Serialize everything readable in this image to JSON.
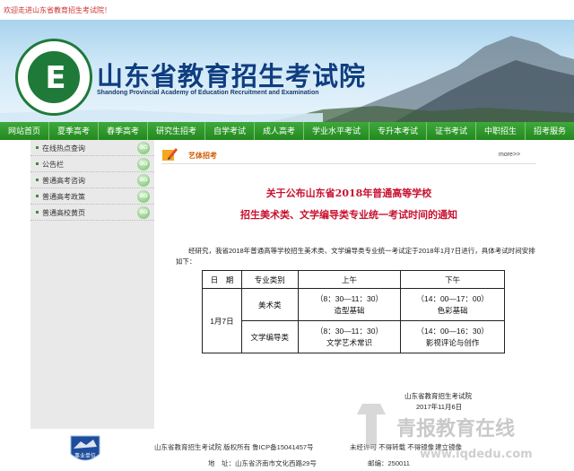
{
  "welcome": "欢迎走进山东省教育招生考试院！",
  "site": {
    "title": "山东省教育招生考试院",
    "subtitle": "Shandong Provincial Academy of Education Recruitment and Examination",
    "logo_letter": "E"
  },
  "nav": [
    "网站首页",
    "夏季高考",
    "春季高考",
    "研究生招考",
    "自学考试",
    "成人高考",
    "学业水平考试",
    "专升本考试",
    "证书考试",
    "中职招生",
    "招考服务"
  ],
  "sidebar": [
    {
      "label": "在线热点查询",
      "go": "GO"
    },
    {
      "label": "公告栏",
      "go": "GO"
    },
    {
      "label": "普通高考咨询",
      "go": "GO"
    },
    {
      "label": "普通高考政策",
      "go": "GO"
    },
    {
      "label": "普通高校黄页",
      "go": "GO"
    }
  ],
  "main": {
    "section_title": "艺体招考",
    "more": "more>>",
    "title_line1": "关于公布山东省2018年普通高等学校",
    "title_line2": "招生美术类、文学编导类专业统一考试时间的通知",
    "body": "经研究，我省2018年普通高等学校招生美术类、文学编导类专业统一考试定于2018年1月7日进行，具体考试时间安排如下：",
    "table": {
      "h_date": "日　期",
      "h_category": "专业类别",
      "h_am": "上午",
      "h_pm": "下午",
      "date": "1月7日",
      "rows": [
        {
          "category": "美术类",
          "am_time": "（8：30—11：30）",
          "am_subject": "造型基础",
          "pm_time": "（14：00—17：00）",
          "pm_subject": "色彩基础"
        },
        {
          "category": "文学编导类",
          "am_time": "（8：30—11：30）",
          "am_subject": "文学艺术常识",
          "pm_time": "（14：00—16：30）",
          "pm_subject": "影视评论与创作"
        }
      ]
    },
    "sign_org": "山东省教育招生考试院",
    "sign_date": "2017年11月6日"
  },
  "footer": {
    "badge_text": "事业单位",
    "line1": "山东省教育招生考试院 版权所有 鲁ICP备15041457号",
    "line1_b": "未经许可 不得转载 不得镜像",
    "line1_c": "建立镜像",
    "line2": "地　址：山东省济南市文化西路29号",
    "line2_b": "邮编：250011"
  },
  "watermark": {
    "text": "青报教育在线",
    "url": "www.iqdedu.com"
  },
  "colors": {
    "nav_green": "#2e9a2b",
    "title_red": "#c8102e",
    "site_title_blue": "#0f3d80"
  }
}
